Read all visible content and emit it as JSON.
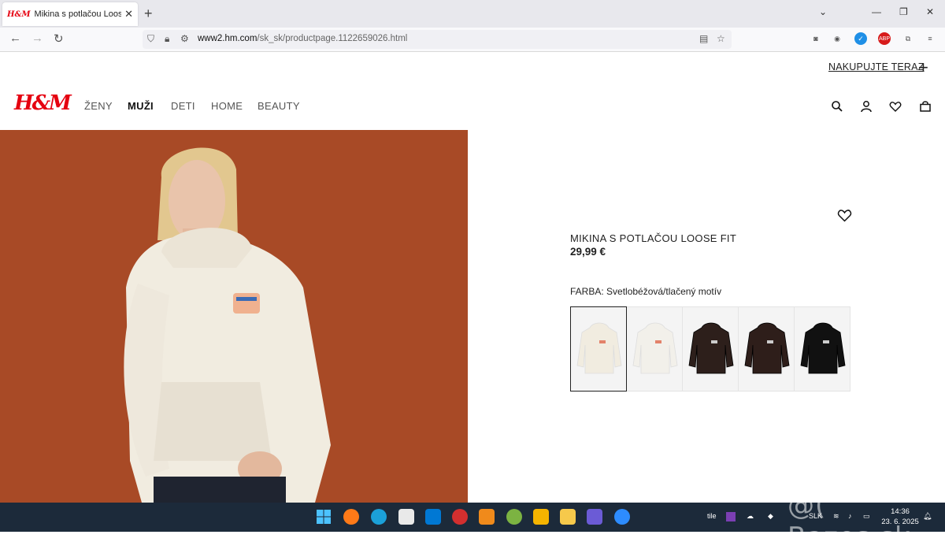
{
  "browser": {
    "tab_favicon": "H&M",
    "tab_title": "Mikina s potlačou Loose Fit - Sv",
    "url_host": "www2.hm.com",
    "url_path": "/sk_sk/productpage.1122659026.html"
  },
  "header": {
    "shop_now": "NAKUPUJTE TERAZ",
    "logo": "H&M",
    "nav": [
      "ŽENY",
      "MUŽI",
      "DETI",
      "HOME",
      "BEAUTY"
    ],
    "active_nav": "MUŽI"
  },
  "product": {
    "name": "MIKINA S POTLAČOU LOOSE FIT",
    "price": "29,99 €",
    "color_label": "FARBA: Svetlobéžová/tlačený motív",
    "swatches": [
      {
        "color": "#f1ece0",
        "selected": true
      },
      {
        "color": "#f2f0ea",
        "selected": false
      },
      {
        "color": "#2d1f1b",
        "selected": false
      },
      {
        "color": "#2e1e1a",
        "selected": false
      },
      {
        "color": "#111111",
        "selected": false
      }
    ]
  },
  "taskbar": {
    "tray_text": "tile",
    "language": "SLK",
    "time": "14:36",
    "date": "23. 6. 2025"
  },
  "watermark": "@( Bazos.sk",
  "colors": {
    "brand_red": "#e50010",
    "hero_bg": "#a84a26",
    "taskbar": "#1c2a3a"
  }
}
